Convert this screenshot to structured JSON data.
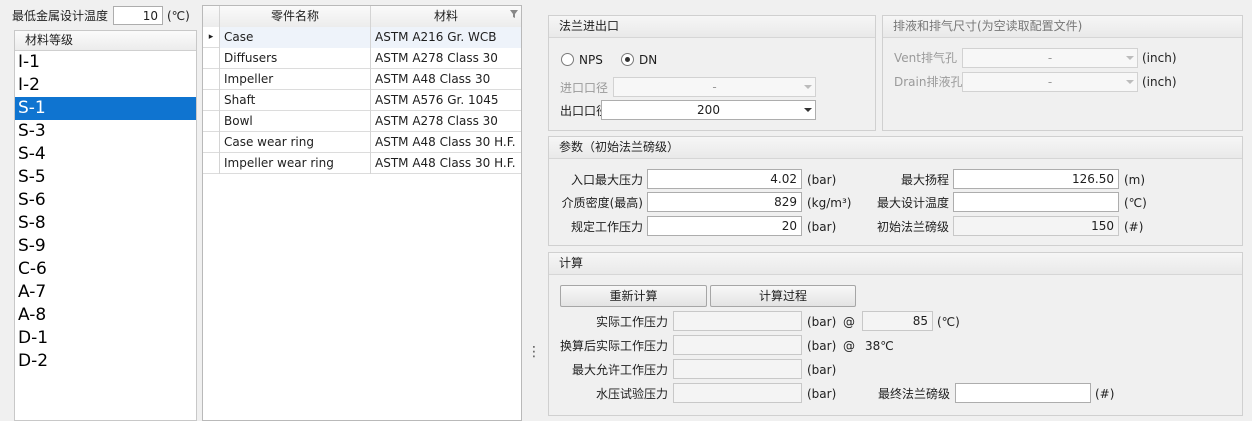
{
  "min_metal_temp": {
    "label": "最低金属设计温度",
    "value": "10",
    "unit": "(℃)"
  },
  "material_grade": {
    "header": "材料等级",
    "items": [
      "I-1",
      "I-2",
      "S-1",
      "S-3",
      "S-4",
      "S-5",
      "S-6",
      "S-8",
      "S-9",
      "C-6",
      "A-7",
      "A-8",
      "D-1",
      "D-2"
    ],
    "selected": "S-1"
  },
  "parts_table": {
    "columns": [
      "零件名称",
      "材料"
    ],
    "rows": [
      {
        "part": "Case",
        "material": "ASTM A216 Gr. WCB"
      },
      {
        "part": "Diffusers",
        "material": "ASTM A278 Class 30"
      },
      {
        "part": "Impeller",
        "material": "ASTM A48 Class  30"
      },
      {
        "part": "Shaft",
        "material": "ASTM A576 Gr. 1045"
      },
      {
        "part": "Bowl",
        "material": "ASTM A278 Class 30"
      },
      {
        "part": "Case wear ring",
        "material": "ASTM A48 Class 30 H.F."
      },
      {
        "part": "Impeller wear ring",
        "material": "ASTM A48 Class 30 H.F."
      }
    ],
    "current_row_marker": "▸"
  },
  "splitter_glyph": "⋮",
  "flange": {
    "title": "法兰进出口",
    "radio_nps": "NPS",
    "radio_dn": "DN",
    "inlet_label": "进口口径",
    "inlet_value": "-",
    "outlet_label": "出口口径",
    "outlet_value": "200"
  },
  "drain": {
    "title": "排液和排气尺寸(为空读取配置文件)",
    "vent_label": "Vent排气孔",
    "vent_value": "-",
    "drain_label": "Drain排液孔",
    "drain_value": "-",
    "unit": "(inch)"
  },
  "params": {
    "title": "参数（初始法兰磅级）",
    "max_inlet_pressure": {
      "label": "入口最大压力",
      "value": "4.02",
      "unit": "(bar)"
    },
    "density": {
      "label": "介质密度(最高)",
      "value": "829",
      "unit": "(kg/m³)"
    },
    "rated_pressure": {
      "label": "规定工作压力",
      "value": "20",
      "unit": "(bar)"
    },
    "max_head": {
      "label": "最大扬程",
      "value": "126.50",
      "unit": "(m)"
    },
    "max_design_temp": {
      "label": "最大设计温度",
      "value": "",
      "unit": "(℃)"
    },
    "initial_class": {
      "label": "初始法兰磅级",
      "value": "150",
      "unit": "(#)"
    }
  },
  "calc": {
    "title": "计算",
    "recalc_button": "重新计算",
    "process_button": "计算过程",
    "actual_pressure": {
      "label": "实际工作压力",
      "value": "",
      "unit": "(bar)",
      "at": "@",
      "temp_value": "85",
      "temp_unit": "(℃)"
    },
    "converted_pressure": {
      "label": "换算后实际工作压力",
      "value": "",
      "unit": "(bar)",
      "at": "@",
      "temp_text": "38℃"
    },
    "max_allowable": {
      "label": "最大允许工作压力",
      "value": "",
      "unit": "(bar)"
    },
    "hydro_test": {
      "label": "水压试验压力",
      "value": "",
      "unit": "(bar)"
    },
    "final_class": {
      "label": "最终法兰磅级",
      "value": "",
      "unit": "(#)"
    }
  },
  "colors": {
    "selection": "#0f74d0"
  }
}
